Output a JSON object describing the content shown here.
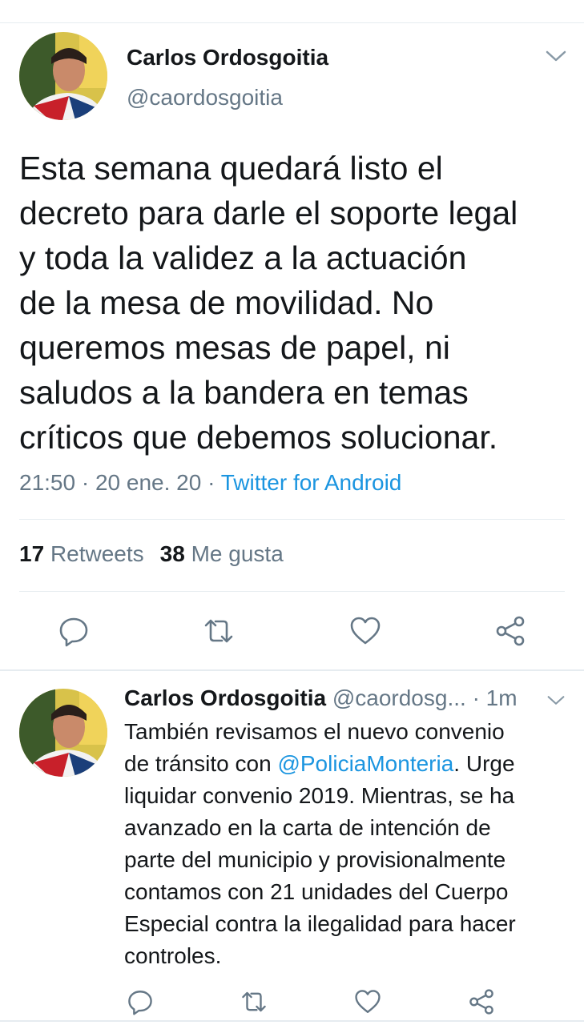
{
  "main_tweet": {
    "author_name": "Carlos Ordosgoitia",
    "author_handle": "@caordosgoitia",
    "text_lines": [
      "Esta semana quedará listo el",
      "decreto para darle el soporte legal",
      "y toda la validez a la actuación",
      "de la mesa de movilidad. No",
      "queremos mesas de papel, ni",
      "saludos a la bandera en temas",
      "críticos que debemos solucionar."
    ],
    "time": "21:50",
    "date": "20 ene. 20",
    "separator": "·",
    "source": "Twitter for Android",
    "retweets_count": "17",
    "retweets_label": "Retweets",
    "likes_count": "38",
    "likes_label": "Me gusta",
    "actions": [
      "reply-icon",
      "retweet-icon",
      "like-icon",
      "share-icon"
    ]
  },
  "reply_tweet": {
    "author_name": "Carlos Ordosgoitia",
    "author_handle": "@caordosg...",
    "separator": "·",
    "time": "1m",
    "line1": "También revisamos el nuevo convenio",
    "line2_prefix": "de tránsito con ",
    "line2_mention": "@PoliciaMonteria",
    "line2_suffix": ". Urge",
    "line3": "liquidar convenio 2019. Mientras, se ha",
    "line4": "avanzado en la carta de intención de",
    "line5": "parte del municipio y provisionalmente",
    "line6": "contamos con 21 unidades del Cuerpo",
    "line7": "Especial contra la ilegalidad para hacer",
    "line8": "controles.",
    "actions": [
      "reply-icon",
      "retweet-icon",
      "like-icon",
      "share-icon"
    ]
  },
  "colors": {
    "text": "#14171a",
    "secondary": "#657786",
    "link": "#1b95e0",
    "divider": "#e6ecf0"
  }
}
